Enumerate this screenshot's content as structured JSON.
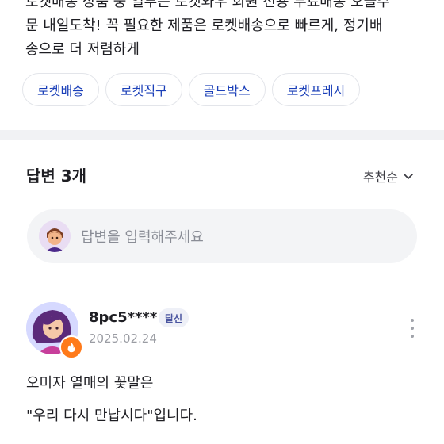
{
  "ad": {
    "line0": "로켓배송 상품 중 일부는 로켓와우 회원 전용 무료배송 오늘주",
    "line1_bold": "",
    "line1": "문 내일도착! 꼭 필요한 제품은 로켓배송으로 빠르게, 정기배",
    "line2": "송으로 더 저렴하게"
  },
  "chips": [
    "로켓배송",
    "로켓직구",
    "골드박스",
    "로켓프레시"
  ],
  "answers": {
    "header": "답변 3개",
    "sort_label": "추천순",
    "input_placeholder": "답변을 입력해주세요"
  },
  "answer": {
    "username": "8pc5****",
    "badge": "달신",
    "date": "2025.02.24",
    "line1": "오미자 열매의 꽃말은",
    "line2": "\"우리 다시 만납시다\"입니다."
  },
  "colors": {
    "chip_text": "#1a3fb8",
    "badge_bg": "#eef0f7",
    "fire_badge": "#ff7a1a"
  }
}
